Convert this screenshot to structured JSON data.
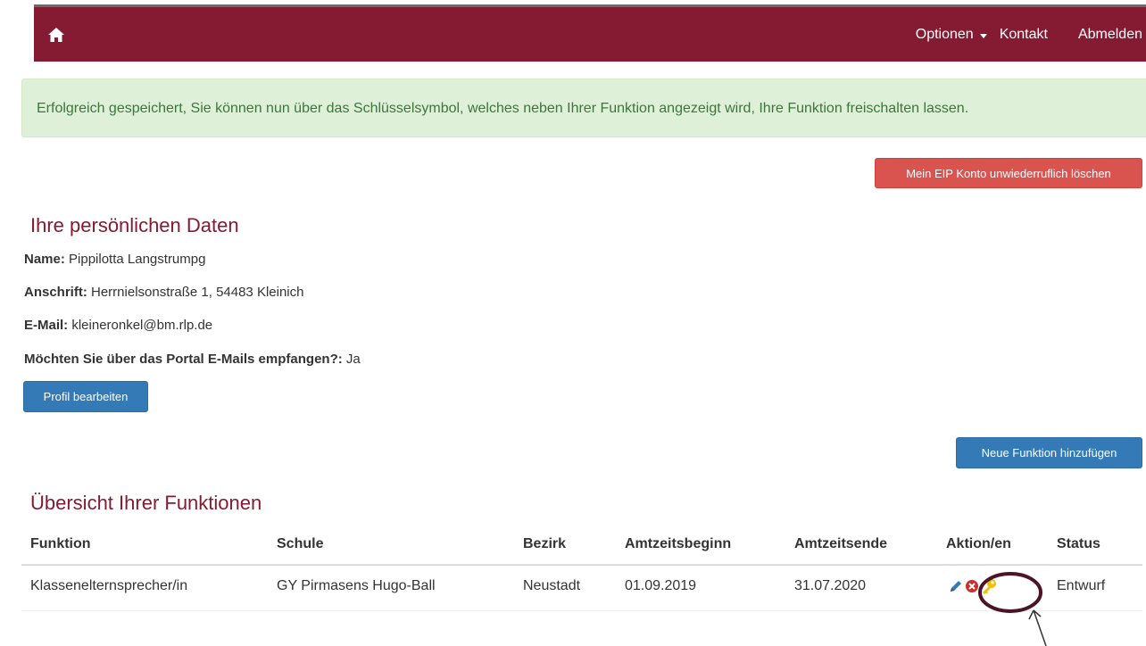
{
  "navbar": {
    "home_icon": "home-icon",
    "items": {
      "optionen": "Optionen",
      "kontakt": "Kontakt",
      "abmelden": "Abmelden"
    },
    "background": "#841b33"
  },
  "alert": {
    "text": "Erfolgreich gespeichert, Sie können nun über das Schlüsselsymbol, welches neben Ihrer Funktion angezeigt wird, Ihre Funktion freischalten lassen."
  },
  "buttons": {
    "delete_account": "Mein EIP Konto unwiederruflich löschen",
    "edit_profile": "Profil bearbeiten",
    "add_function": "Neue Funktion hinzufügen"
  },
  "personal": {
    "title": "Ihre persönlichen Daten",
    "name_label": "Name:",
    "name_value": " Pippilotta Langstrumpg",
    "address_label": "Anschrift:",
    "address_value": " Herrnielsonstraße 1, 54483 Kleinich",
    "email_label": "E-Mail:",
    "email_value": " kleineronkel@bm.rlp.de",
    "newsletter_label": "Möchten Sie über das Portal E-Mails empfangen?:",
    "newsletter_value": " Ja"
  },
  "functions": {
    "title": "Übersicht Ihrer Funktionen",
    "headers": [
      "Funktion",
      "Schule",
      "Bezirk",
      "Amtzeitsbeginn",
      "Amtzeitsende",
      "Aktion/en",
      "Status"
    ],
    "rows": [
      {
        "funktion": "Klassenelternsprecher/in",
        "schule": "GY Pirmasens Hugo-Ball",
        "bezirk": "Neustadt",
        "beginn": "01.09.2019",
        "ende": "31.07.2020",
        "actions": [
          "pencil-icon",
          "delete-circle-icon",
          "key-icon"
        ],
        "status": "Entwurf"
      }
    ]
  },
  "colors": {
    "accent": "#841b33",
    "primary": "#337ab7",
    "danger": "#d9534f",
    "success_bg": "#dff0d8",
    "success_text": "#3c763d",
    "key": "#f0c000"
  }
}
